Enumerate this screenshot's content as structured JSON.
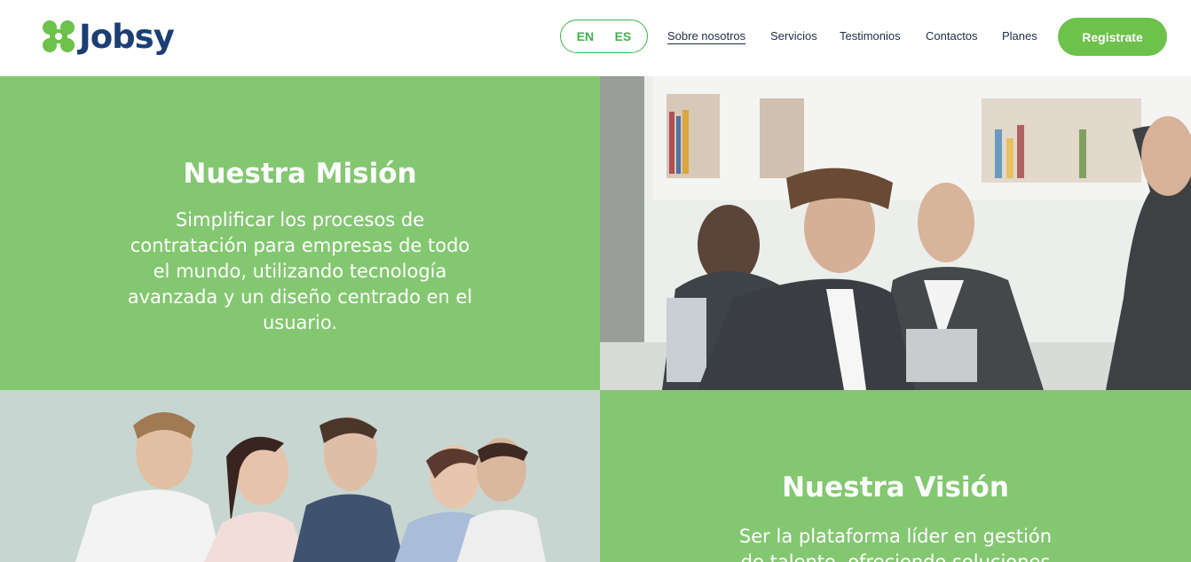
{
  "header": {
    "brand": "Jobsy",
    "lang": {
      "en": "EN",
      "es": "ES"
    },
    "nav": [
      {
        "label": "Sobre nosotros"
      },
      {
        "label": "Servicios"
      },
      {
        "label": "Testimonios"
      },
      {
        "label": "Contactos"
      },
      {
        "label": "Planes"
      }
    ],
    "cta_label": "Registrate"
  },
  "mission": {
    "title": "Nuestra Misión",
    "text": "Simplificar los procesos de contratación para empresas de todo el mundo, utilizando tecnología avanzada y un diseño centrado en el usuario."
  },
  "vision": {
    "title": "Nuestra Visión",
    "text": "Ser la plataforma líder en gestión de talento, ofreciendo soluciones"
  },
  "colors": {
    "brand_green": "#6cc24a",
    "panel_green": "#84c771",
    "brand_navy": "#1c3f73"
  }
}
